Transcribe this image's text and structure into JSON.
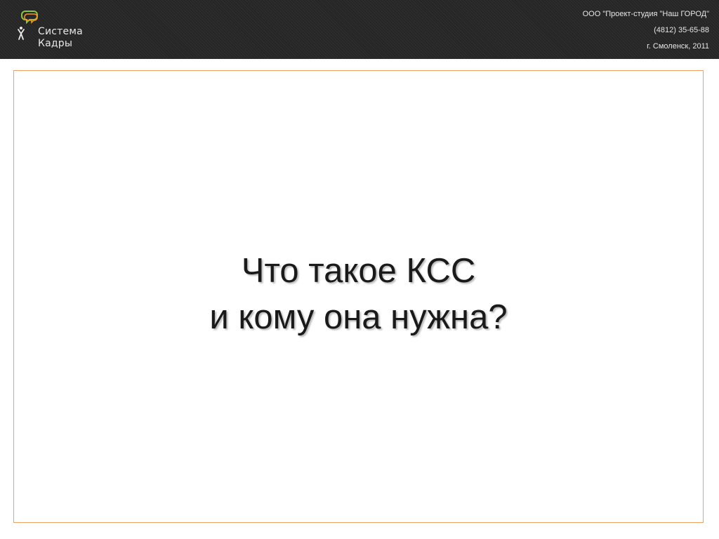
{
  "header": {
    "logo": {
      "line1": "Система",
      "line2": "Кадры"
    },
    "company": {
      "name": "ООО \"Проект-студия \"Наш ГОРОД\"",
      "phone": "(4812) 35-65-88",
      "location": "г. Смоленск, 2011"
    }
  },
  "slide": {
    "title_line1": "Что такое КСС",
    "title_line2": "и кому она нужна?"
  },
  "colors": {
    "header_bg": "#262626",
    "frame_border": "#f0a060",
    "logo_bubble_green": "#8cc63f",
    "logo_bubble_orange": "#f7941d"
  }
}
